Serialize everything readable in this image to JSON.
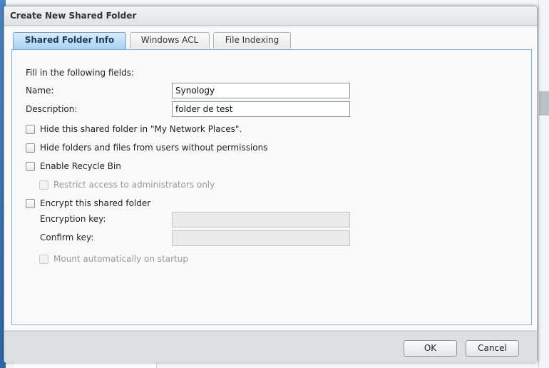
{
  "dialog": {
    "title": "Create New Shared Folder"
  },
  "tabs": [
    {
      "label": "Shared Folder Info",
      "active": true
    },
    {
      "label": "Windows ACL",
      "active": false
    },
    {
      "label": "File Indexing",
      "active": false
    }
  ],
  "form": {
    "intro": "Fill in the following fields:",
    "name_label": "Name:",
    "name_value": "Synology",
    "description_label": "Description:",
    "description_value": "folder de test",
    "hide_in_network_places": {
      "label": "Hide this shared folder in \"My Network Places\".",
      "checked": false,
      "enabled": true
    },
    "hide_without_permissions": {
      "label": "Hide folders and files from users without permissions",
      "checked": false,
      "enabled": true
    },
    "enable_recycle_bin": {
      "label": "Enable Recycle Bin",
      "checked": false,
      "enabled": true
    },
    "restrict_admins": {
      "label": "Restrict access to administrators only",
      "checked": false,
      "enabled": false
    },
    "encrypt_folder": {
      "label": "Encrypt this shared folder",
      "checked": false,
      "enabled": true
    },
    "encryption_key_label": "Encryption key:",
    "encryption_key_value": "",
    "confirm_key_label": "Confirm key:",
    "confirm_key_value": "",
    "mount_on_startup": {
      "label": "Mount automatically on startup",
      "checked": false,
      "enabled": false
    }
  },
  "footer": {
    "ok_label": "OK",
    "cancel_label": "Cancel"
  },
  "colors": {
    "active_tab": "#a9d3f3",
    "panel_border": "#7fb0d8",
    "desktop_blue": "#2d67ac"
  }
}
